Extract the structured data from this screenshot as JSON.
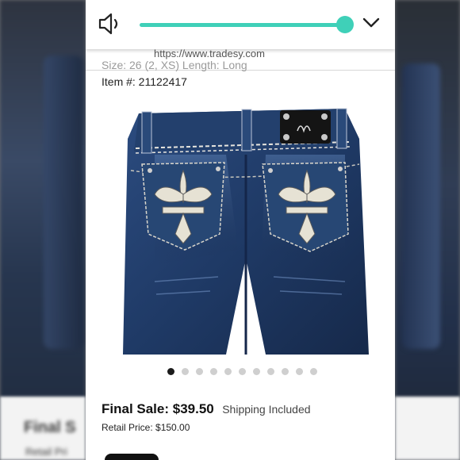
{
  "controls": {
    "volume_icon": "speaker-icon",
    "volume_level": 0.96,
    "collapse_icon": "chevron-down-icon",
    "accent_color": "#3fd0b8"
  },
  "browser": {
    "url": "https://www.tradesy.com"
  },
  "listing": {
    "partial_line": "Size: 26 (2, XS) Length: Long",
    "item_number": "Item #: 21122417",
    "photo_alt": "denim-jeans-back-pockets",
    "carousel": {
      "count": 11,
      "active_index": 0
    },
    "final_sale": "Final Sale: $39.50",
    "shipping": "Shipping Included",
    "retail_price": "Retail Price: $150.00"
  },
  "background": {
    "ghost_title": "Final S",
    "ghost_sub": "Retail Pri"
  }
}
